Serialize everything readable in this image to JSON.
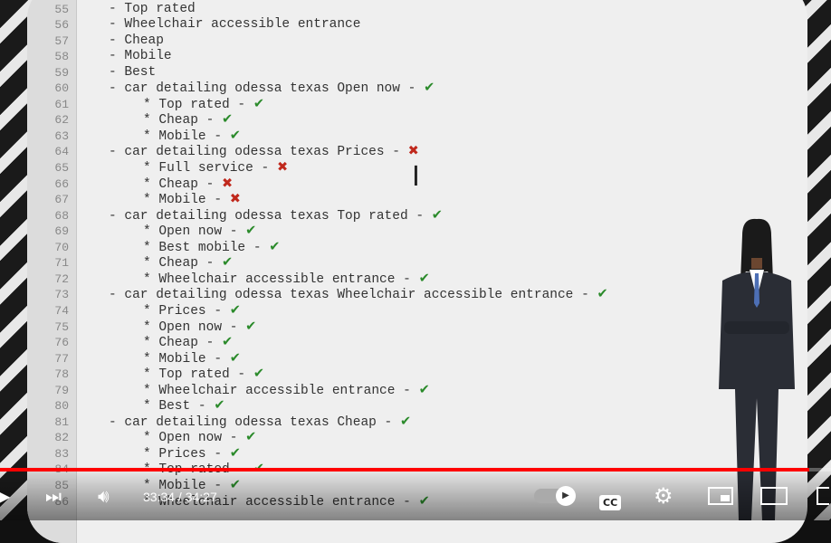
{
  "editor": {
    "lines": [
      {
        "n": "55",
        "indent": 1,
        "text": "- Top rated",
        "mark": ""
      },
      {
        "n": "56",
        "indent": 1,
        "text": "- Wheelchair accessible entrance",
        "mark": ""
      },
      {
        "n": "57",
        "indent": 1,
        "text": "- Cheap",
        "mark": ""
      },
      {
        "n": "58",
        "indent": 1,
        "text": "- Mobile",
        "mark": ""
      },
      {
        "n": "59",
        "indent": 1,
        "text": "- Best",
        "mark": ""
      },
      {
        "n": "60",
        "indent": 1,
        "text": "- car detailing odessa texas Open now - ",
        "mark": "check"
      },
      {
        "n": "61",
        "indent": 2,
        "text": "* Top rated - ",
        "mark": "check"
      },
      {
        "n": "62",
        "indent": 2,
        "text": "* Cheap - ",
        "mark": "check"
      },
      {
        "n": "63",
        "indent": 2,
        "text": "* Mobile - ",
        "mark": "check"
      },
      {
        "n": "64",
        "indent": 1,
        "text": "- car detailing odessa texas Prices - ",
        "mark": "cross"
      },
      {
        "n": "65",
        "indent": 2,
        "text": "* Full service - ",
        "mark": "cross"
      },
      {
        "n": "66",
        "indent": 2,
        "text": "* Cheap - ",
        "mark": "cross"
      },
      {
        "n": "67",
        "indent": 2,
        "text": "* Mobile - ",
        "mark": "cross"
      },
      {
        "n": "68",
        "indent": 1,
        "text": "- car detailing odessa texas Top rated - ",
        "mark": "check"
      },
      {
        "n": "69",
        "indent": 2,
        "text": "* Open now - ",
        "mark": "check"
      },
      {
        "n": "70",
        "indent": 2,
        "text": "* Best mobile - ",
        "mark": "check"
      },
      {
        "n": "71",
        "indent": 2,
        "text": "* Cheap - ",
        "mark": "check"
      },
      {
        "n": "72",
        "indent": 2,
        "text": "* Wheelchair accessible entrance - ",
        "mark": "check"
      },
      {
        "n": "73",
        "indent": 1,
        "text": "- car detailing odessa texas Wheelchair accessible entrance - ",
        "mark": "check"
      },
      {
        "n": "74",
        "indent": 2,
        "text": "* Prices - ",
        "mark": "check"
      },
      {
        "n": "75",
        "indent": 2,
        "text": "* Open now - ",
        "mark": "check"
      },
      {
        "n": "76",
        "indent": 2,
        "text": "* Cheap - ",
        "mark": "check"
      },
      {
        "n": "77",
        "indent": 2,
        "text": "* Mobile - ",
        "mark": "check"
      },
      {
        "n": "78",
        "indent": 2,
        "text": "* Top rated - ",
        "mark": "check"
      },
      {
        "n": "79",
        "indent": 2,
        "text": "* Wheelchair accessible entrance - ",
        "mark": "check"
      },
      {
        "n": "80",
        "indent": 2,
        "text": "* Best - ",
        "mark": "check"
      },
      {
        "n": "81",
        "indent": 1,
        "text": "- car detailing odessa texas Cheap - ",
        "mark": "check"
      },
      {
        "n": "82",
        "indent": 2,
        "text": "* Open now - ",
        "mark": "check"
      },
      {
        "n": "83",
        "indent": 2,
        "text": "* Prices - ",
        "mark": "check"
      },
      {
        "n": "84",
        "indent": 2,
        "text": "* Top rated - ",
        "mark": "check"
      },
      {
        "n": "85",
        "indent": 2,
        "text": "* Mobile - ",
        "mark": "check"
      },
      {
        "n": "86",
        "indent": 2,
        "text": "* Wheelchair accessible entrance - ",
        "mark": "check"
      }
    ]
  },
  "player": {
    "current_time": "33:34",
    "duration": "34:27",
    "time_display": "33:34 / 34:27",
    "progress_percent": 97.4,
    "progress_color": "#ff0000",
    "cc_label": "CC"
  },
  "colors": {
    "check": "#2a8a2a",
    "cross": "#c0281c"
  }
}
